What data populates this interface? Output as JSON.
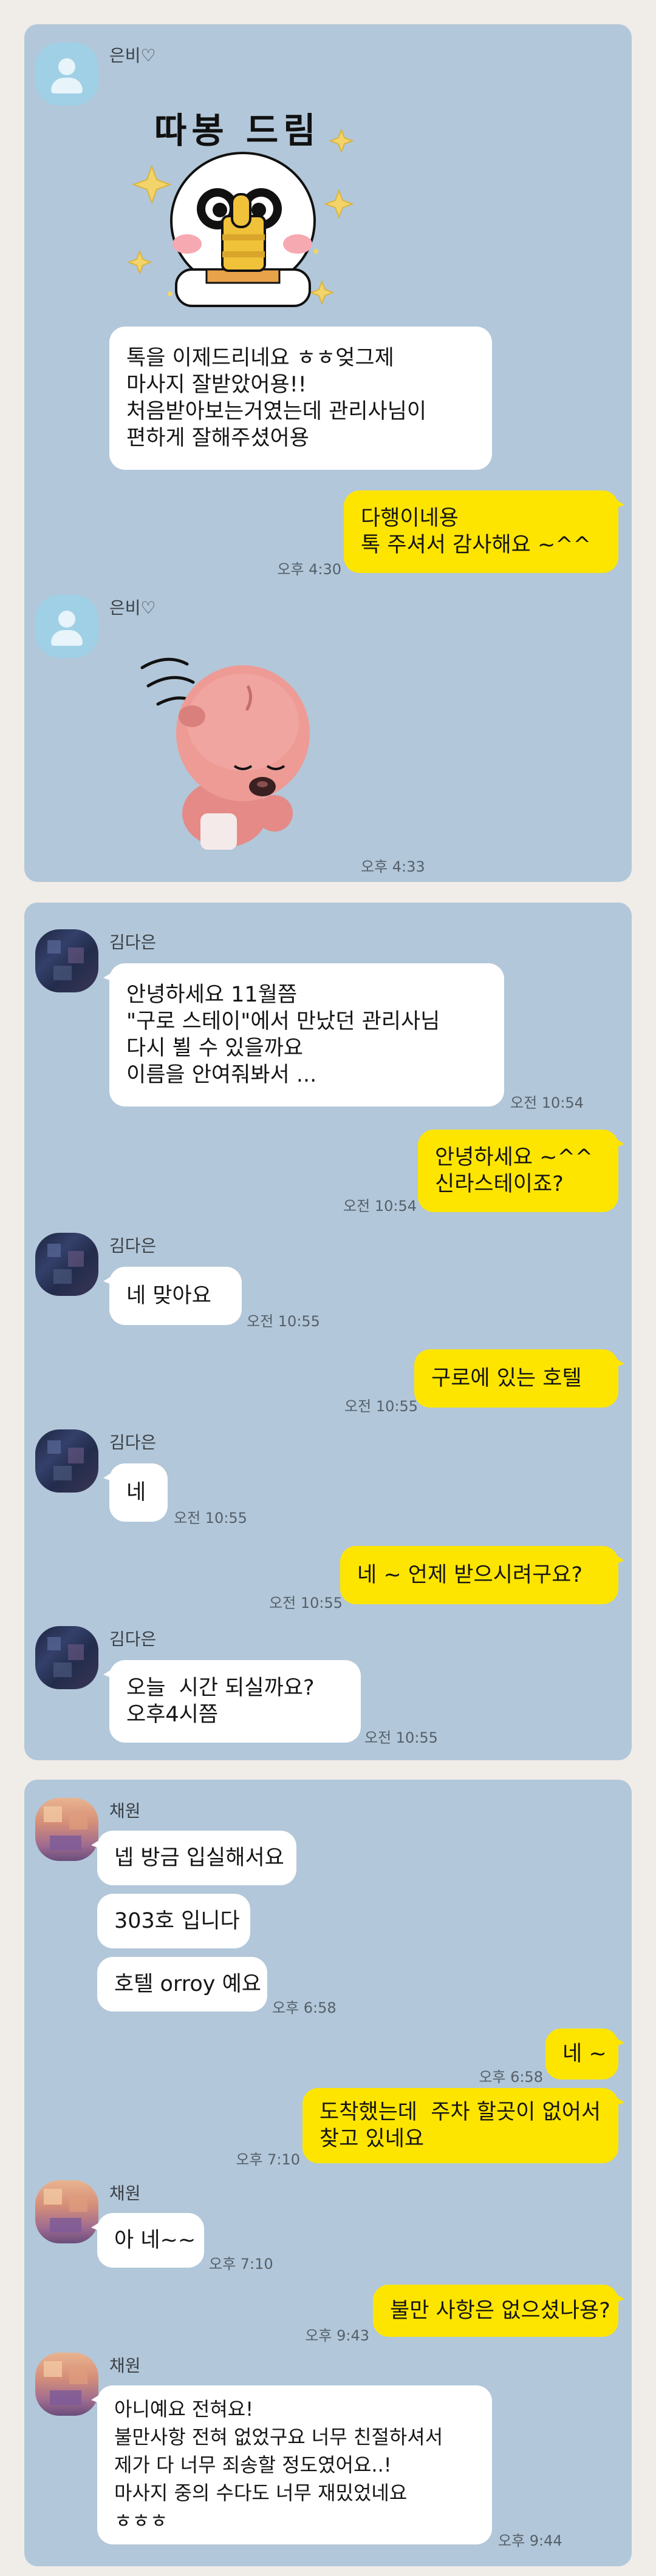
{
  "panel1": {
    "sender1": {
      "name": "은비♡",
      "avatar": "default-person-icon"
    },
    "sticker1": {
      "caption": "따봉 드림",
      "name": "thumbs-up-character-sticker"
    },
    "msg1": {
      "lines": "톡을 이제드리네요 ㅎㅎ엊그제\n마사지 잘받았어용!!\n처음받아보는거였는데 관리사님이\n편하게 잘해주셨어용"
    },
    "reply1": {
      "lines": "다행이네용\n톡 주셔서 감사해요 ~^^",
      "time": "오후 4:30"
    },
    "sender2": {
      "name": "은비♡"
    },
    "sticker2": {
      "name": "bowing-pink-bear-sticker",
      "time": "오후 4:33"
    }
  },
  "panel2": {
    "sender": {
      "name": "김다은"
    },
    "msg1": {
      "lines": "안녕하세요 11월쯤\n\"구로 스테이\"에서 만났던 관리사님\n다시 뵐 수 있을까요\n이름을 안여줘봐서 ...",
      "time": "오전 10:54"
    },
    "reply1": {
      "lines": "안녕하세요 ~^^\n신라스테이죠?",
      "time": "오전 10:54"
    },
    "msg2": {
      "text": "네 맞아요",
      "time": "오전 10:55"
    },
    "reply2": {
      "text": "구로에 있는 호텔",
      "time": "오전 10:55"
    },
    "msg3": {
      "text": "네",
      "time": "오전 10:55"
    },
    "reply3": {
      "text": "네 ~ 언제 받으시려구요?",
      "time": "오전 10:55"
    },
    "msg4": {
      "lines": "오늘  시간 되실까요?\n오후4시쯤",
      "time": "오전 10:55"
    }
  },
  "panel3": {
    "sender": {
      "name": "채원"
    },
    "msg1": {
      "text": "넵 방금 입실해서요"
    },
    "msg2": {
      "text": "303호 입니다"
    },
    "msg3": {
      "text": "호텔 orroy 예요",
      "time": "오후 6:58"
    },
    "reply1": {
      "text": "네 ~",
      "time": "오후 6:58"
    },
    "reply2": {
      "lines": "도착했는데  주차 할곳이 없어서\n찾고 있네요",
      "time": "오후 7:10"
    },
    "msg4": {
      "text": "아 네~~",
      "time": "오후 7:10"
    },
    "reply3": {
      "text": "불만 사항은 없으셨나용?",
      "time": "오후 9:43"
    },
    "msg5": {
      "lines": "아니예요 전혀요!\n불만사항 전혀 없었구요 너무 친절하셔서\n제가 다 너무 죄송할 정도였어요..!\n마사지 중의 수다도 너무 재밌었네요\nㅎㅎㅎ",
      "time": "오후 9:44"
    }
  },
  "colors": {
    "chat_background": "#b2c7d9",
    "outgoing_bubble": "#fee500",
    "incoming_bubble": "#ffffff",
    "page_background": "#f0ece8"
  }
}
